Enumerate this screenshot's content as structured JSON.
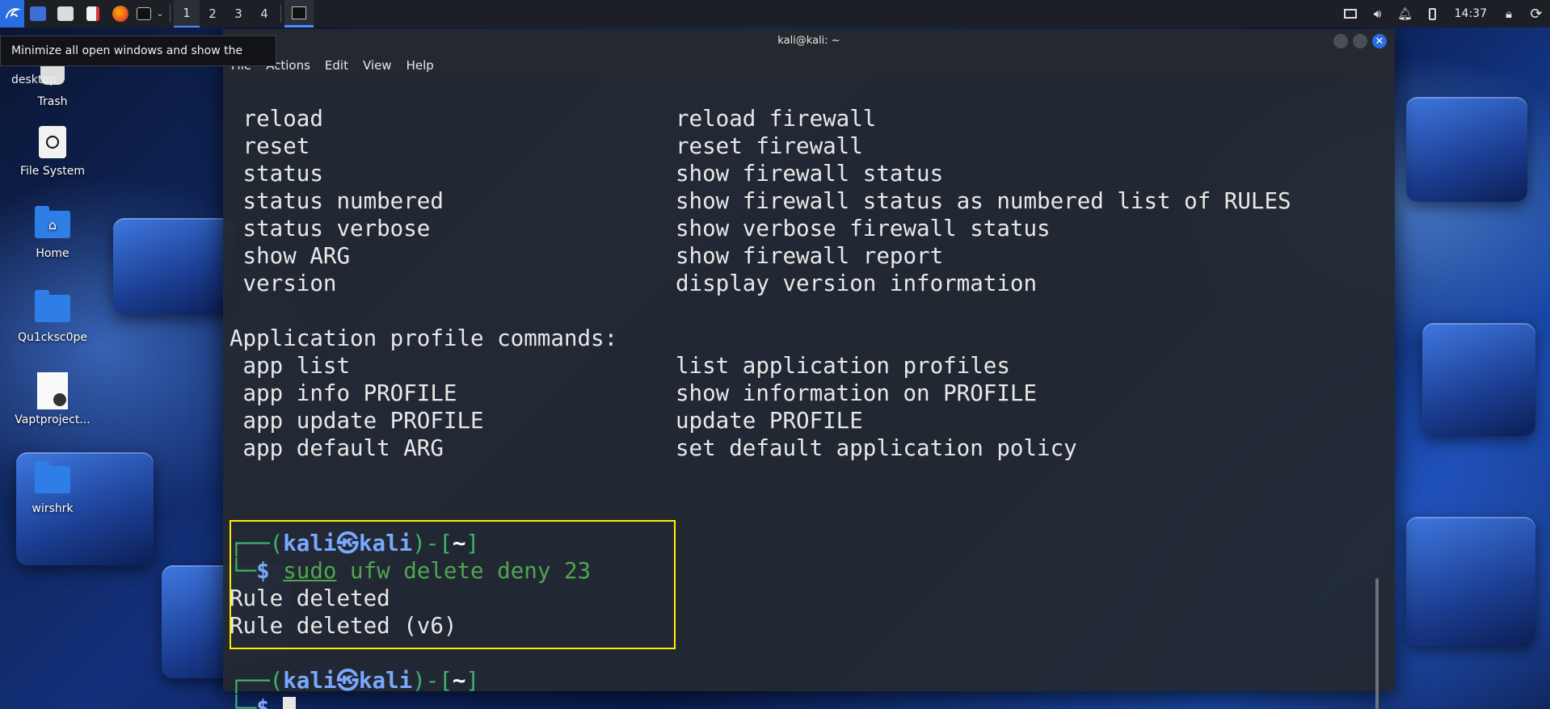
{
  "panel": {
    "workspaces": [
      "1",
      "2",
      "3",
      "4"
    ],
    "clock": "14:37"
  },
  "tooltip": "Minimize all open windows and show the desktop",
  "desktop": {
    "icons": [
      {
        "label": "Trash"
      },
      {
        "label": "File System"
      },
      {
        "label": "Home"
      },
      {
        "label": "Qu1cksc0pe"
      },
      {
        "label": "Vaptproject..."
      },
      {
        "label": "wirshrk"
      }
    ]
  },
  "window": {
    "title": "kali@kali: ~",
    "menu": [
      "File",
      "Actions",
      "Edit",
      "View",
      "Help"
    ]
  },
  "terminal": {
    "rows": [
      {
        "cmd": " reload",
        "desc": "reload firewall"
      },
      {
        "cmd": " reset",
        "desc": "reset firewall"
      },
      {
        "cmd": " status",
        "desc": "show firewall status"
      },
      {
        "cmd": " status numbered",
        "desc": "show firewall status as numbered list of RULES"
      },
      {
        "cmd": " status verbose",
        "desc": "show verbose firewall status"
      },
      {
        "cmd": " show ARG",
        "desc": "show firewall report"
      },
      {
        "cmd": " version",
        "desc": "display version information"
      }
    ],
    "app_header": "Application profile commands:",
    "app_rows": [
      {
        "cmd": " app list",
        "desc": "list application profiles"
      },
      {
        "cmd": " app info PROFILE",
        "desc": "show information on PROFILE"
      },
      {
        "cmd": " app update PROFILE",
        "desc": "update PROFILE"
      },
      {
        "cmd": " app default ARG",
        "desc": "set default application policy"
      }
    ],
    "prompt": {
      "open": "┌──(",
      "user": "kali",
      "at": "㉿",
      "host": "kali",
      "mid": ")-[",
      "dir": "~",
      "close": "]",
      "corner": "└─",
      "dollar": "$"
    },
    "command": {
      "sudo": "sudo",
      "rest": " ufw delete deny 23"
    },
    "output": [
      "Rule deleted",
      "Rule deleted (v6)"
    ]
  }
}
